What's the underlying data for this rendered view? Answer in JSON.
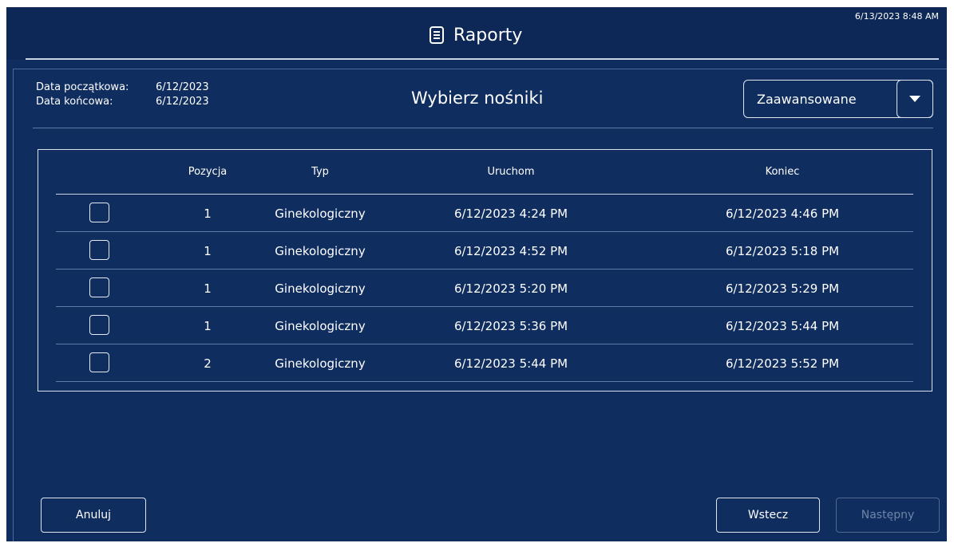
{
  "header": {
    "title": "Raporty",
    "datetime": "6/13/2023 8:48 AM",
    "icon": "document-icon"
  },
  "dates": {
    "start_label": "Data początkowa:",
    "start_value": "6/12/2023",
    "end_label": "Data końcowa:",
    "end_value": "6/12/2023"
  },
  "subtitle": "Wybierz nośniki",
  "filter_dropdown": {
    "selected": "Zaawansowane",
    "icon": "caret-down-icon"
  },
  "table": {
    "columns": {
      "position": "Pozycja",
      "type": "Typ",
      "start": "Uruchom",
      "end": "Koniec"
    },
    "rows": [
      {
        "position": "1",
        "type": "Ginekologiczny",
        "start": "6/12/2023 4:24 PM",
        "end": "6/12/2023 4:46 PM",
        "checked": false
      },
      {
        "position": "1",
        "type": "Ginekologiczny",
        "start": "6/12/2023 4:52 PM",
        "end": "6/12/2023 5:18 PM",
        "checked": false
      },
      {
        "position": "1",
        "type": "Ginekologiczny",
        "start": "6/12/2023 5:20 PM",
        "end": "6/12/2023 5:29 PM",
        "checked": false
      },
      {
        "position": "1",
        "type": "Ginekologiczny",
        "start": "6/12/2023 5:36 PM",
        "end": "6/12/2023 5:44 PM",
        "checked": false
      },
      {
        "position": "2",
        "type": "Ginekologiczny",
        "start": "6/12/2023 5:44 PM",
        "end": "6/12/2023 5:52 PM",
        "checked": false
      }
    ]
  },
  "buttons": {
    "cancel": "Anuluj",
    "back": "Wstecz",
    "next": "Następny"
  },
  "colors": {
    "background": "#0f2d5e",
    "header": "#0d2756",
    "text": "#ffffff",
    "disabled_text": "#6f85a8"
  }
}
